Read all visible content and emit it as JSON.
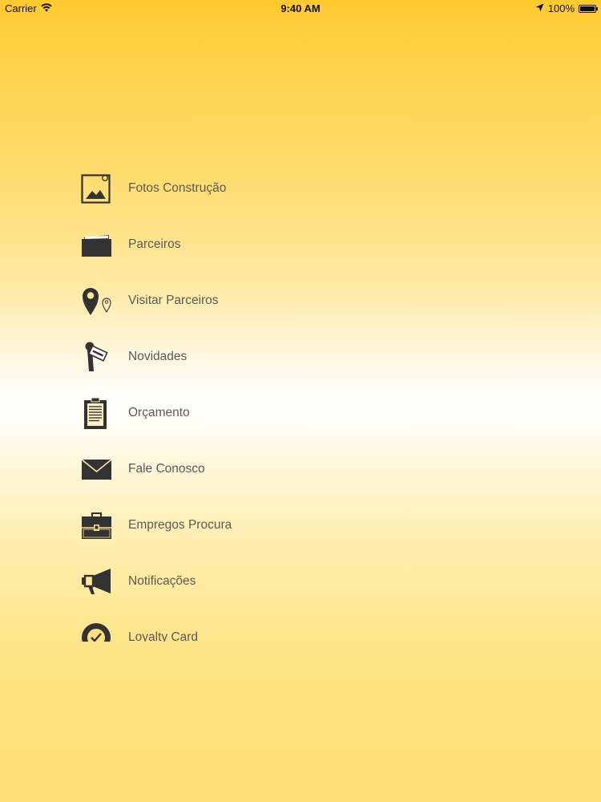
{
  "status_bar": {
    "carrier": "Carrier",
    "time": "9:40 AM",
    "battery": "100%",
    "battery_level": 1.0
  },
  "menu": {
    "items": [
      {
        "label": "Fotos Construção",
        "icon": "photo-icon"
      },
      {
        "label": "Parceiros",
        "icon": "folder-icon"
      },
      {
        "label": "Visitar Parceiros",
        "icon": "map-pin-icon"
      },
      {
        "label": "Novidades",
        "icon": "news-microphone-icon"
      },
      {
        "label": "Orçamento",
        "icon": "clipboard-icon"
      },
      {
        "label": "Fale Conosco",
        "icon": "envelope-icon"
      },
      {
        "label": "Empregos Procura",
        "icon": "briefcase-icon"
      },
      {
        "label": "Notificações",
        "icon": "megaphone-icon"
      },
      {
        "label": "Loyalty Card",
        "icon": "badge-icon"
      }
    ]
  }
}
